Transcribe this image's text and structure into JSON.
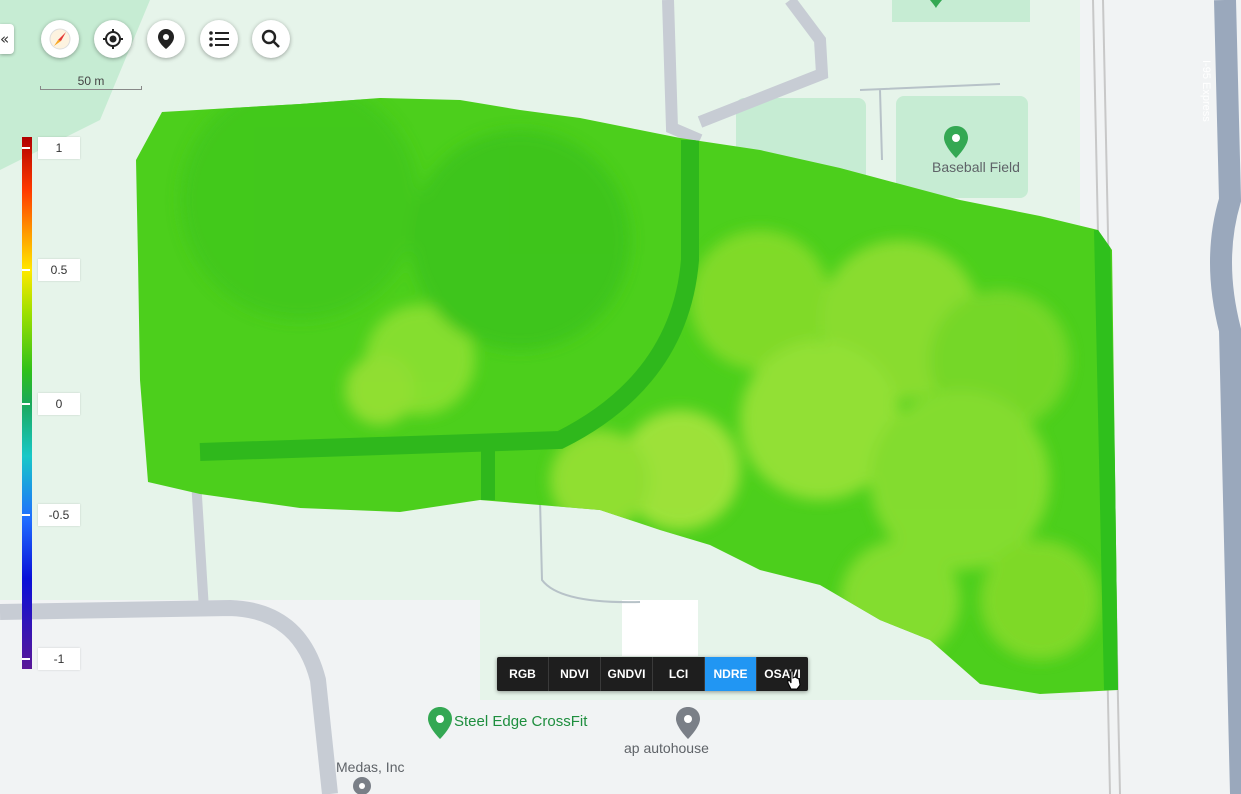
{
  "controls": {
    "collapse_icon": "«",
    "buttons": [
      "compass-icon",
      "locate-icon",
      "pin-icon",
      "list-icon",
      "search-icon"
    ]
  },
  "scale": {
    "label": "50 m"
  },
  "legend": {
    "ticks": [
      "1",
      "0.5",
      "0",
      "-0.5",
      "-1"
    ],
    "colors": [
      "#b00000",
      "#ff9a00",
      "#ffe800",
      "#2fc01a",
      "#18c8c8",
      "#1f6cff",
      "#5a1898"
    ]
  },
  "layers": {
    "items": [
      "RGB",
      "NDVI",
      "GNDVI",
      "LCI",
      "NDRE",
      "OSAVI"
    ],
    "active": "NDRE"
  },
  "pois": {
    "baseball": "Baseball Field",
    "crossfit": "Steel Edge CrossFit",
    "autohouse": "ap autohouse",
    "medas": "Medas, Inc",
    "road": "I-95 Express"
  },
  "colors": {
    "park": "#cdeed8",
    "road": "#c9ced6",
    "overlay": "#4ccf1c",
    "active": "#2196f3"
  }
}
